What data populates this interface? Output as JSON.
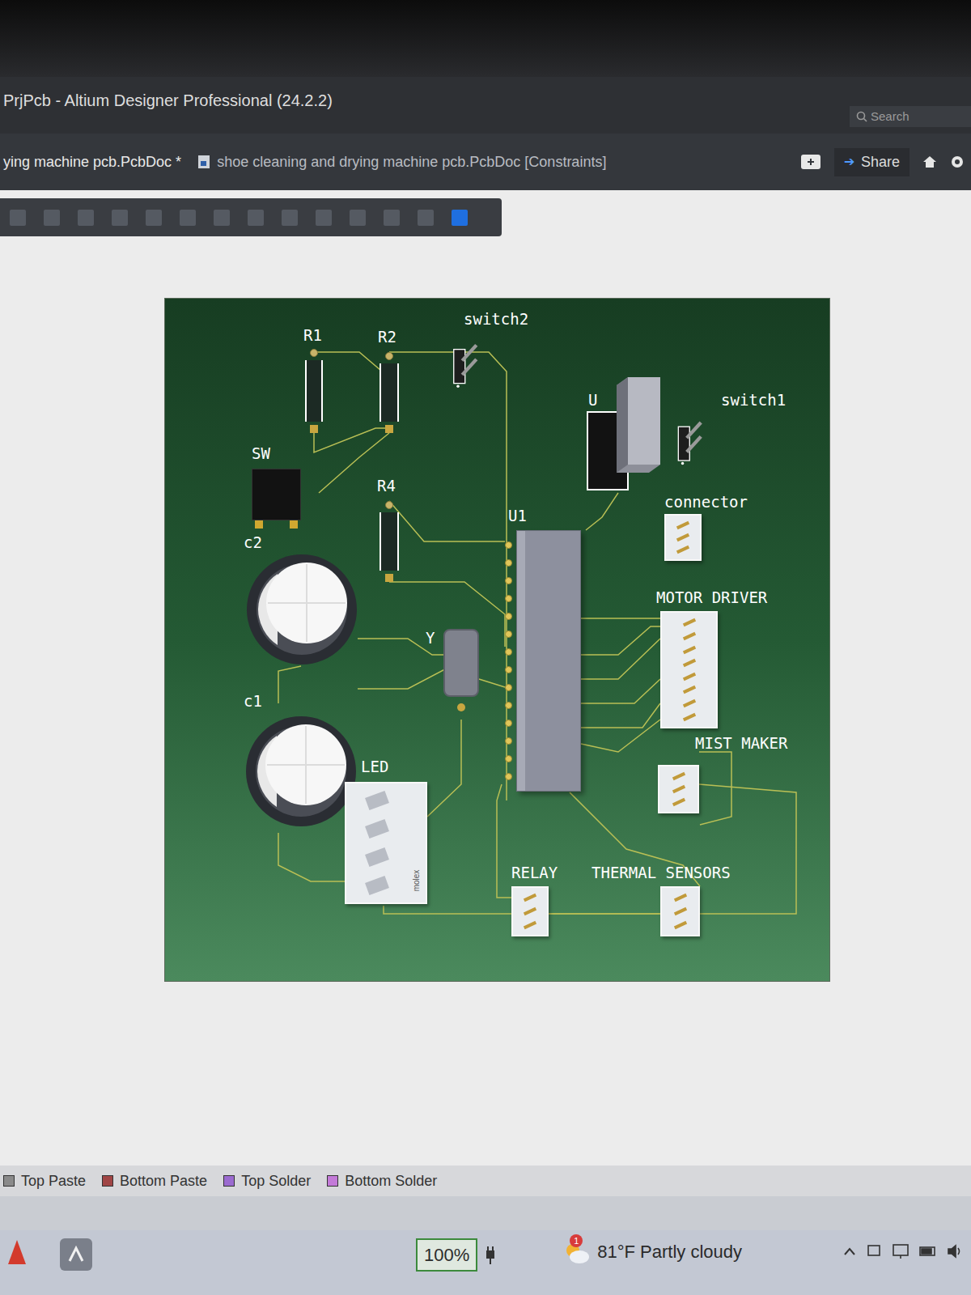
{
  "window": {
    "title": "PrjPcb - Altium Designer Professional (24.2.2)"
  },
  "search": {
    "placeholder": "Search"
  },
  "tabs": [
    {
      "label": "ying machine pcb.PcbDoc *",
      "selected": true
    },
    {
      "label": "shoe cleaning and drying machine pcb.PcbDoc [Constraints]",
      "selected": false
    }
  ],
  "share_button": "Share",
  "board": {
    "components": [
      {
        "label": "R1",
        "kind": "resistor"
      },
      {
        "label": "R2",
        "kind": "resistor"
      },
      {
        "label": "switch2",
        "kind": "header"
      },
      {
        "label": "U",
        "kind": "module"
      },
      {
        "label": "switch1",
        "kind": "header"
      },
      {
        "label": "SW",
        "kind": "tactile"
      },
      {
        "label": "R4",
        "kind": "resistor"
      },
      {
        "label": "connector",
        "kind": "connector"
      },
      {
        "label": "U1",
        "kind": "chip"
      },
      {
        "label": "c2",
        "kind": "capacitor"
      },
      {
        "label": "Y",
        "kind": "crystal"
      },
      {
        "label": "MOTOR DRIVER",
        "kind": "connector"
      },
      {
        "label": "c1",
        "kind": "capacitor"
      },
      {
        "label": "LED",
        "kind": "connector",
        "marking": "molex"
      },
      {
        "label": "MIST MAKER",
        "kind": "connector"
      },
      {
        "label": "RELAY",
        "kind": "connector"
      },
      {
        "label": "THERMAL SENSORS",
        "kind": "connector"
      }
    ]
  },
  "layers": [
    {
      "label": "Top Paste",
      "color": "#8a8a8a"
    },
    {
      "label": "Bottom Paste",
      "color": "#a04545"
    },
    {
      "label": "Top Solder",
      "color": "#9b6bd0"
    },
    {
      "label": "Bottom Solder",
      "color": "#c37ad8"
    }
  ],
  "taskbar": {
    "zoom": "100%",
    "weather": "81°F  Partly cloudy",
    "weather_badge": "1"
  }
}
